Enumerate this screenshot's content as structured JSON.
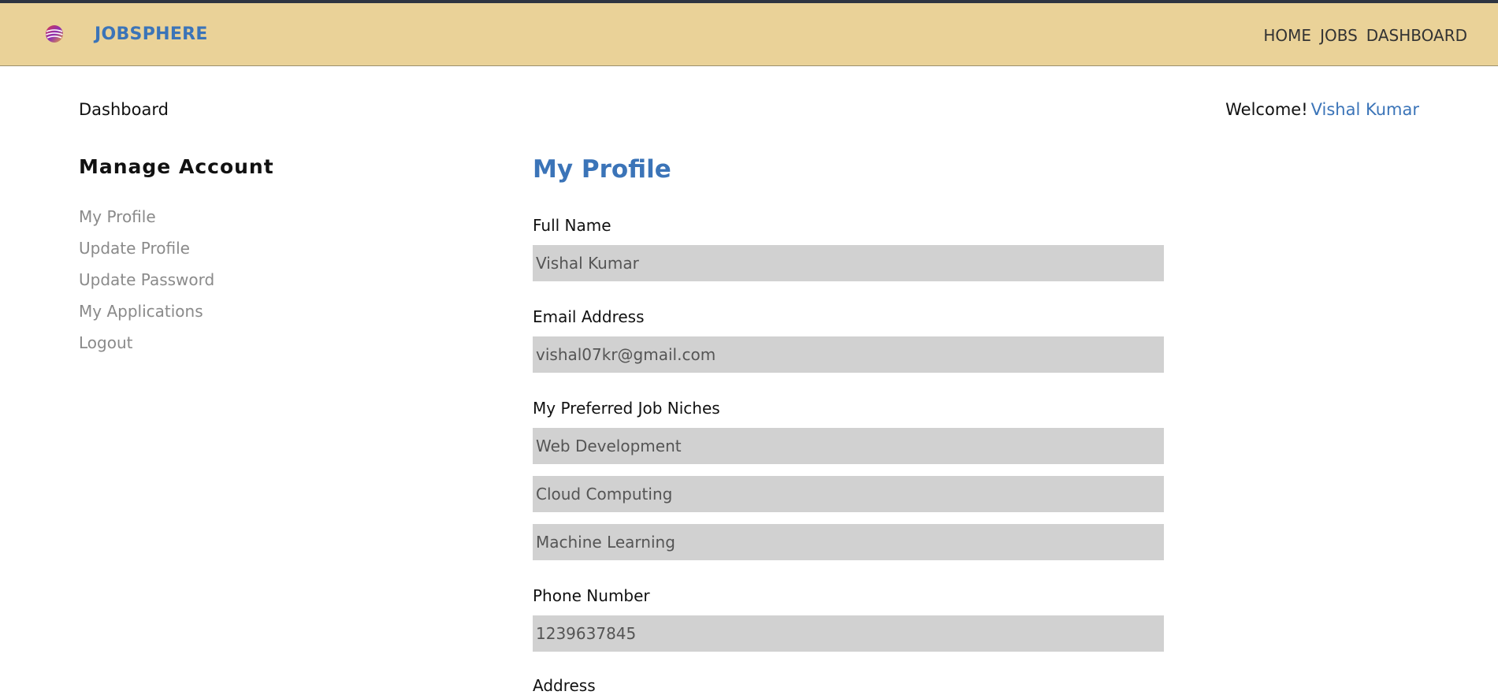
{
  "navbar": {
    "brand": "JOBSPHERE",
    "logo_icon": "globe-icon",
    "links": [
      "HOME",
      "JOBS",
      "DASHBOARD"
    ]
  },
  "header": {
    "breadcrumb": "Dashboard",
    "welcome_label": "Welcome!",
    "user_name": "Vishal Kumar"
  },
  "sidebar": {
    "title": "Manage Account",
    "items": [
      "My Profile",
      "Update Profile",
      "Update Password",
      "My Applications",
      "Logout"
    ]
  },
  "profile": {
    "title": "My Profile",
    "full_name_label": "Full Name",
    "full_name": "Vishal Kumar",
    "email_label": "Email Address",
    "email": "vishal07kr@gmail.com",
    "niches_label": "My Preferred Job Niches",
    "niches": [
      "Web Development",
      "Cloud Computing",
      "Machine Learning"
    ],
    "phone_label": "Phone Number",
    "phone": "1239637845",
    "address_label": "Address"
  },
  "colors": {
    "navbar_bg": "#ead298",
    "accent": "#3b74b8",
    "input_bg": "#d1d1d1",
    "muted_text": "#8a8a8a"
  }
}
